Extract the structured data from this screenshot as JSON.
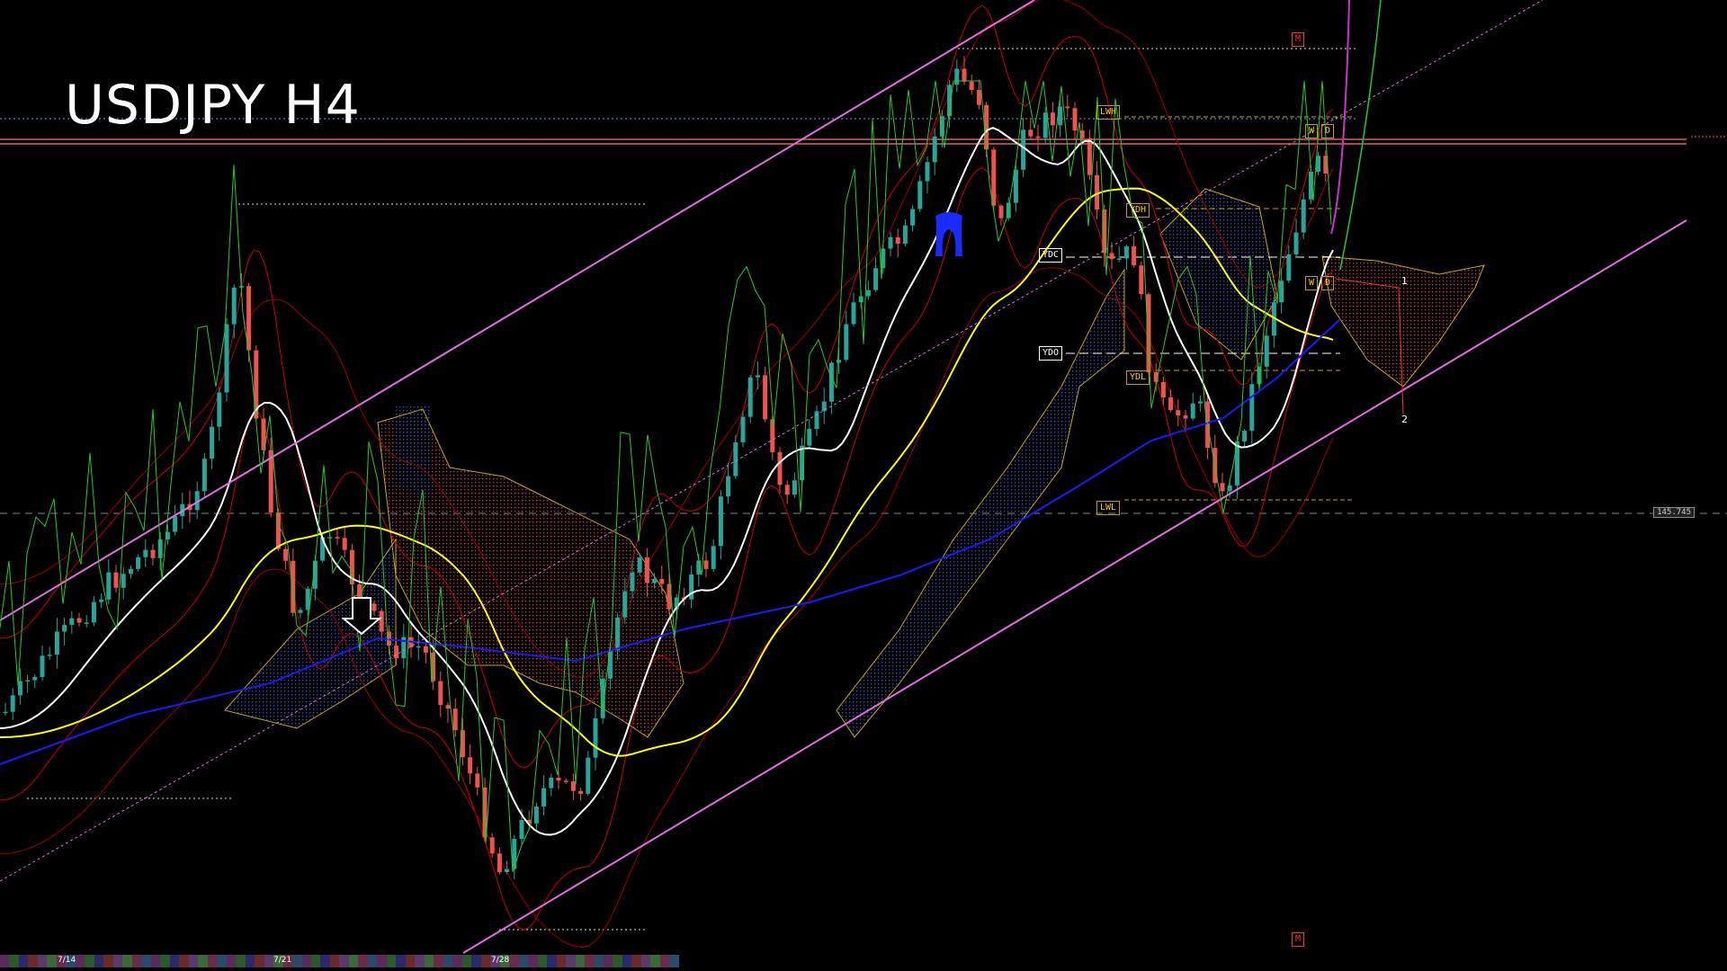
{
  "chart_data": {
    "type": "candlestick",
    "title": "USDJPY H4",
    "x_labels": [
      "7/14",
      "7/21",
      "7/28"
    ],
    "last_price_label": "145.745",
    "level_tags": [
      "LWH",
      "YDH",
      "YDC",
      "YDO",
      "YDL",
      "LWL",
      "W",
      "D",
      "M"
    ],
    "wave_labels": [
      "1",
      "2"
    ],
    "colors": {
      "bull": "#26a69a",
      "bear": "#ef5350",
      "channel": "#e070e0",
      "ma_fast": "#ffffff",
      "ma_mid": "#ffff00",
      "ma_slow": "#1a1aff",
      "bollinger": "#cc0000",
      "oscillator": "#22cc22",
      "kumo_bull": "#2233aa",
      "kumo_bear": "#aa2222"
    }
  },
  "labels": {
    "title": "USDJPY H4",
    "d1": "7/14",
    "d2": "7/21",
    "d3": "7/28",
    "price": "145.745",
    "lwh": "LWH",
    "ydh": "YDH",
    "ydc": "YDC",
    "ydo": "YDO",
    "ydl": "YDL",
    "lwl": "LWL",
    "w": "W",
    "d": "D",
    "m": "M",
    "wave1": "1",
    "wave2": "2"
  }
}
